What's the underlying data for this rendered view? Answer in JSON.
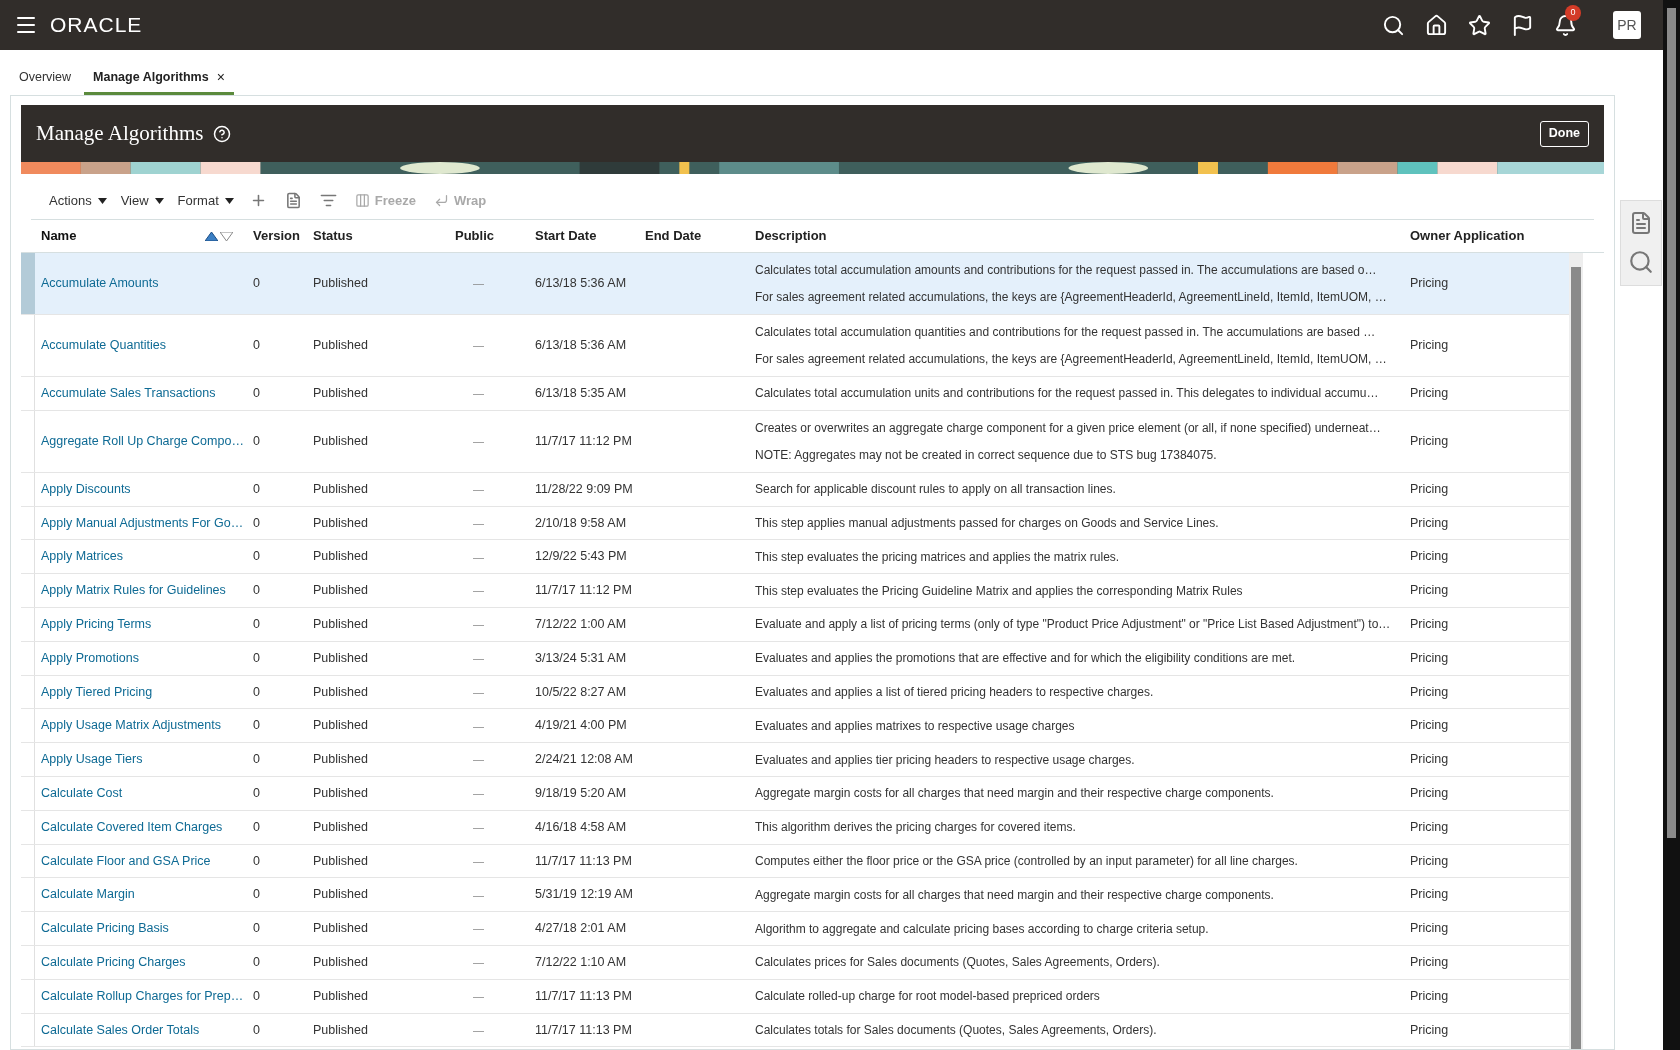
{
  "top_bar": {
    "logo": "ORACLE",
    "notification_count": "0",
    "avatar": "PR"
  },
  "tabs": [
    {
      "label": "Overview",
      "selected": false
    },
    {
      "label": "Manage Algorithms",
      "selected": true,
      "close": "×"
    }
  ],
  "page": {
    "title": "Manage Algorithms",
    "done_button": "Done"
  },
  "toolbar": [
    {
      "kind": "menu",
      "label": "Actions",
      "disabled": false
    },
    {
      "kind": "menu",
      "label": "View",
      "disabled": false
    },
    {
      "kind": "menu",
      "label": "Format",
      "disabled": false
    },
    {
      "kind": "add",
      "disabled": false
    },
    {
      "kind": "detach",
      "disabled": false
    },
    {
      "kind": "filter",
      "disabled": false
    },
    {
      "kind": "freeze",
      "label": "Freeze",
      "disabled": true
    },
    {
      "kind": "wrap",
      "label": "Wrap",
      "disabled": true
    }
  ],
  "table": {
    "columns": [
      {
        "label": "Name",
        "sorted_ascending": true
      },
      {
        "label": "Version",
        "sorted_ascending": false
      },
      {
        "label": "Status",
        "sorted_ascending": false
      },
      {
        "label": "Public",
        "sorted_ascending": false
      },
      {
        "label": "Start Date",
        "sorted_ascending": false
      },
      {
        "label": "End Date",
        "sorted_ascending": false
      },
      {
        "label": "Description",
        "sorted_ascending": false
      },
      {
        "label": "Owner Application",
        "sorted_ascending": false
      }
    ],
    "rows": [
      {
        "name": "Accumulate Amounts",
        "version": "0",
        "status": "Published",
        "public": "—",
        "start": "6/13/18 5:36 AM",
        "description": [
          "Calculates total accumulation amounts and contributions for the request passed in. The accumulations are based o…",
          "For sales agreement related accumulations, the keys are {AgreementHeaderId, AgreementLineId, ItemId, ItemUOM, …"
        ],
        "owner": "Pricing",
        "selected": true
      },
      {
        "name": "Accumulate Quantities",
        "version": "0",
        "status": "Published",
        "public": "—",
        "start": "6/13/18 5:36 AM",
        "description": [
          "Calculates total accumulation quantities and contributions for the request passed in. The accumulations are based …",
          "For sales agreement related accumulations, the keys are {AgreementHeaderId, AgreementLineId, ItemId, ItemUOM, …"
        ],
        "owner": "Pricing",
        "selected": false
      },
      {
        "name": "Accumulate Sales Transactions",
        "version": "0",
        "status": "Published",
        "public": "—",
        "start": "6/13/18 5:35 AM",
        "description": [
          "Calculates total accumulation units and contributions for the request passed in. This delegates to individual accumu…"
        ],
        "owner": "Pricing",
        "selected": false
      },
      {
        "name": "Aggregate Roll Up Charge Compo…",
        "version": "0",
        "status": "Published",
        "public": "—",
        "start": "11/7/17 11:12 PM",
        "description": [
          "Creates or overwrites an aggregate charge component for a given price element (or all, if none specified) underneat…",
          "NOTE: Aggregates may not be created in correct sequence due to STS bug 17384075."
        ],
        "owner": "Pricing",
        "selected": false
      },
      {
        "name": "Apply Discounts",
        "version": "0",
        "status": "Published",
        "public": "—",
        "start": "11/28/22 9:09 PM",
        "description": [
          "Search for applicable discount rules to apply on all transaction lines."
        ],
        "owner": "Pricing",
        "selected": false
      },
      {
        "name": "Apply Manual Adjustments For Go…",
        "version": "0",
        "status": "Published",
        "public": "—",
        "start": "2/10/18 9:58 AM",
        "description": [
          "This step applies manual adjustments passed for charges on Goods and Service Lines."
        ],
        "owner": "Pricing",
        "selected": false
      },
      {
        "name": "Apply Matrices",
        "version": "0",
        "status": "Published",
        "public": "—",
        "start": "12/9/22 5:43 PM",
        "description": [
          "This step evaluates the pricing matrices and applies the matrix rules."
        ],
        "owner": "Pricing",
        "selected": false
      },
      {
        "name": "Apply Matrix Rules for Guidelines",
        "version": "0",
        "status": "Published",
        "public": "—",
        "start": "11/7/17 11:12 PM",
        "description": [
          "This step evaluates the Pricing Guideline Matrix and applies the corresponding Matrix Rules"
        ],
        "owner": "Pricing",
        "selected": false
      },
      {
        "name": "Apply Pricing Terms",
        "version": "0",
        "status": "Published",
        "public": "—",
        "start": "7/12/22 1:00 AM",
        "description": [
          "Evaluate and apply a list of pricing terms (only of type \"Product Price Adjustment\" or \"Price List Based Adjustment\") to…"
        ],
        "owner": "Pricing",
        "selected": false
      },
      {
        "name": "Apply Promotions",
        "version": "0",
        "status": "Published",
        "public": "—",
        "start": "3/13/24 5:31 AM",
        "description": [
          "Evaluates and applies the promotions that are effective and for which the eligibility conditions are met."
        ],
        "owner": "Pricing",
        "selected": false
      },
      {
        "name": "Apply Tiered Pricing",
        "version": "0",
        "status": "Published",
        "public": "—",
        "start": "10/5/22 8:27 AM",
        "description": [
          "Evaluates and applies a list of tiered pricing headers to respective charges."
        ],
        "owner": "Pricing",
        "selected": false
      },
      {
        "name": "Apply Usage Matrix Adjustments",
        "version": "0",
        "status": "Published",
        "public": "—",
        "start": "4/19/21 4:00 PM",
        "description": [
          "Evaluates and applies matrixes to respective usage charges"
        ],
        "owner": "Pricing",
        "selected": false
      },
      {
        "name": "Apply Usage Tiers",
        "version": "0",
        "status": "Published",
        "public": "—",
        "start": "2/24/21 12:08 AM",
        "description": [
          "Evaluates and applies tier pricing headers to respective usage charges."
        ],
        "owner": "Pricing",
        "selected": false
      },
      {
        "name": "Calculate Cost",
        "version": "0",
        "status": "Published",
        "public": "—",
        "start": "9/18/19 5:20 AM",
        "description": [
          "Aggregate margin costs for all charges that need margin and their respective charge components."
        ],
        "owner": "Pricing",
        "selected": false
      },
      {
        "name": "Calculate Covered Item Charges",
        "version": "0",
        "status": "Published",
        "public": "—",
        "start": "4/16/18 4:58 AM",
        "description": [
          "This algorithm derives the pricing charges for covered items."
        ],
        "owner": "Pricing",
        "selected": false
      },
      {
        "name": "Calculate Floor and GSA Price",
        "version": "0",
        "status": "Published",
        "public": "—",
        "start": "11/7/17 11:13 PM",
        "description": [
          "Computes either the floor price or the GSA price (controlled by an input parameter) for all line charges."
        ],
        "owner": "Pricing",
        "selected": false
      },
      {
        "name": "Calculate Margin",
        "version": "0",
        "status": "Published",
        "public": "—",
        "start": "5/31/19 12:19 AM",
        "description": [
          "Aggregate margin costs for all charges that need margin and their respective charge components."
        ],
        "owner": "Pricing",
        "selected": false
      },
      {
        "name": "Calculate Pricing Basis",
        "version": "0",
        "status": "Published",
        "public": "—",
        "start": "4/27/18 2:01 AM",
        "description": [
          "Algorithm to aggregate and calculate pricing bases according to charge criteria setup."
        ],
        "owner": "Pricing",
        "selected": false
      },
      {
        "name": "Calculate Pricing Charges",
        "version": "0",
        "status": "Published",
        "public": "—",
        "start": "7/12/22 1:10 AM",
        "description": [
          "Calculates prices for Sales documents (Quotes, Sales Agreements, Orders)."
        ],
        "owner": "Pricing",
        "selected": false
      },
      {
        "name": "Calculate Rollup Charges for Prep…",
        "version": "0",
        "status": "Published",
        "public": "—",
        "start": "11/7/17 11:13 PM",
        "description": [
          "Calculate rolled-up charge for root model-based prepriced orders"
        ],
        "owner": "Pricing",
        "selected": false
      },
      {
        "name": "Calculate Sales Order Totals",
        "version": "0",
        "status": "Published",
        "public": "—",
        "start": "11/7/17 11:13 PM",
        "description": [
          "Calculates totals for Sales documents (Quotes, Sales Agreements, Orders)."
        ],
        "owner": "Pricing",
        "selected": false
      }
    ]
  }
}
